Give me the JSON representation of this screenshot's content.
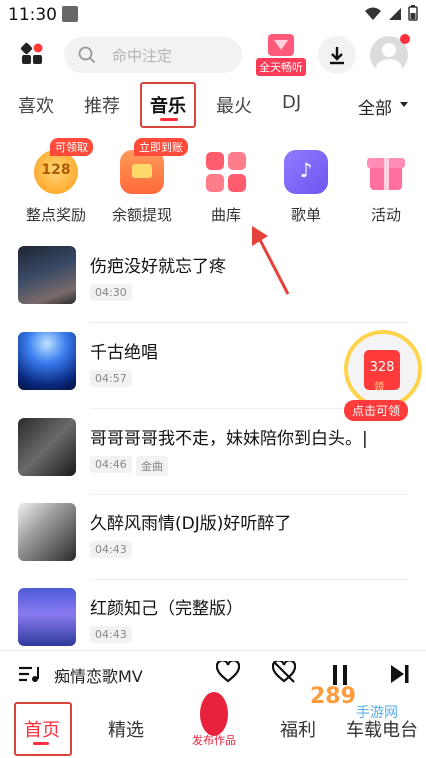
{
  "status_bar": {
    "time": "11:30"
  },
  "header": {
    "search_placeholder": "命中注定",
    "promo_label": "全天畅听"
  },
  "tabs": {
    "items": [
      "喜欢",
      "推荐",
      "音乐",
      "最火",
      "DJ"
    ],
    "active": "音乐",
    "more_label": "全部"
  },
  "quick_icons": [
    {
      "label": "整点奖励",
      "badge": "可领取",
      "value": "128"
    },
    {
      "label": "余额提现",
      "badge": "立即到账"
    },
    {
      "label": "曲库"
    },
    {
      "label": "歌单"
    },
    {
      "label": "活动"
    }
  ],
  "songs": [
    {
      "title": "伤疤没好就忘了疼",
      "duration": "04:30"
    },
    {
      "title": "千古绝唱",
      "duration": "04:57"
    },
    {
      "title": "哥哥哥哥我不走，妹妹陪你到白头。|",
      "duration": "04:46",
      "tag": "金曲"
    },
    {
      "title": "久醉风雨情(DJ版)好听醉了",
      "duration": "04:43"
    },
    {
      "title": "红颜知己（完整版）",
      "duration": "04:43"
    }
  ],
  "reward_float": {
    "amount": "328",
    "sub": "领",
    "claim_label": "点击可领"
  },
  "player": {
    "now_playing": "痴情恋歌MV"
  },
  "bottom_nav": {
    "home": "首页",
    "picks": "精选",
    "publish": "发布作品",
    "welfare": "福利",
    "car_radio": "车载电台"
  },
  "watermark": {
    "text": "289",
    "sub": "手游网"
  },
  "colors": {
    "accent": "#ff2d3d",
    "annotation": "#d9453b"
  }
}
